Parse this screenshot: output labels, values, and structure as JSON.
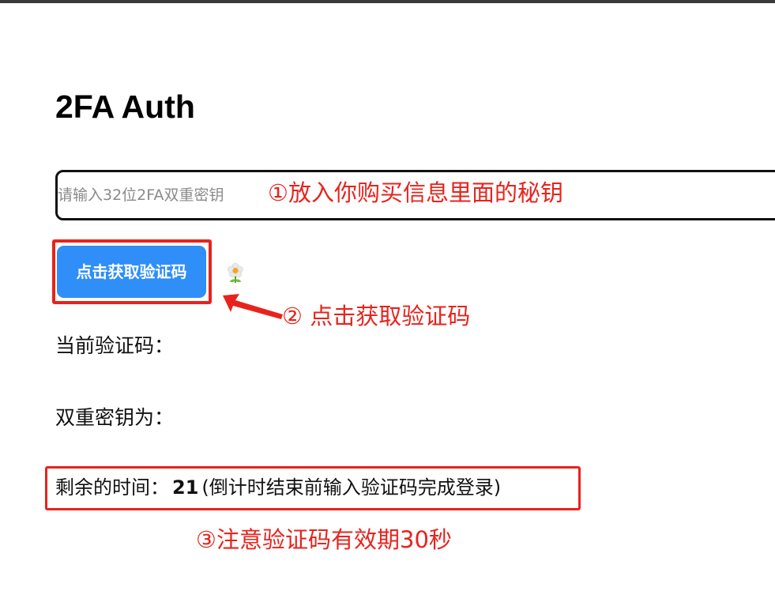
{
  "page": {
    "title": "2FA Auth"
  },
  "secret_input": {
    "placeholder": "请输入32位2FA双重密钥",
    "value": ""
  },
  "get_code_button": {
    "label": "点击获取验证码"
  },
  "current_code": {
    "label": "当前验证码：",
    "value": ""
  },
  "secret_key": {
    "label": "双重密钥为：",
    "value": ""
  },
  "timer": {
    "label": "剩余的时间：",
    "seconds": "21",
    "note": "(倒计时结束前输入验证码完成登录)"
  },
  "annotations": {
    "step1": "①放入你购买信息里面的秘钥",
    "step2": "② 点击获取验证码",
    "step3": "③注意验证码有效期30秒"
  },
  "colors": {
    "annotation_red": "#e8231c",
    "button_blue": "#2f8ef8",
    "input_border": "#111111"
  },
  "icons": {
    "flower": "flower-icon",
    "arrow": "arrow-left-icon"
  }
}
